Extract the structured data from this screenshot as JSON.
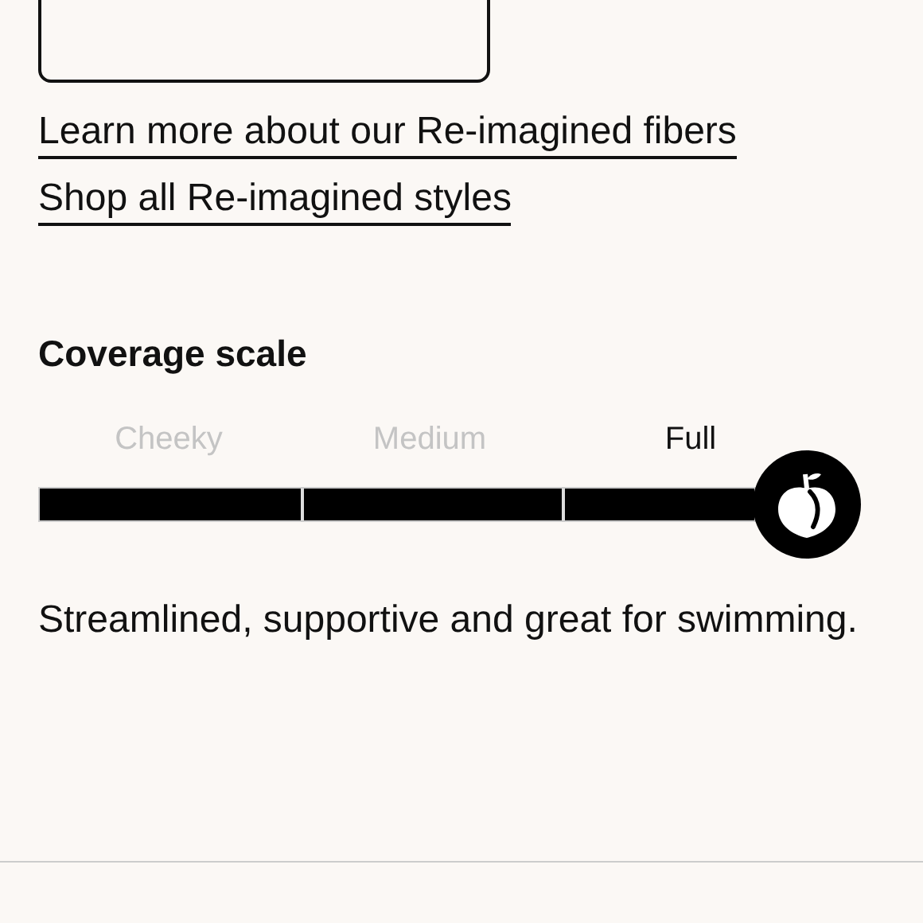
{
  "links": [
    {
      "label": "Learn more about our Re-imagined fibers"
    },
    {
      "label": "Shop all Re-imagined styles"
    }
  ],
  "coverage_scale": {
    "title": "Coverage scale",
    "level": 1,
    "options": [
      {
        "label": "Cheeky",
        "selected": false
      },
      {
        "label": "Medium",
        "selected": false
      },
      {
        "label": "Full",
        "selected": true
      }
    ],
    "description": "Streamlined, supportive and great for swimming."
  }
}
